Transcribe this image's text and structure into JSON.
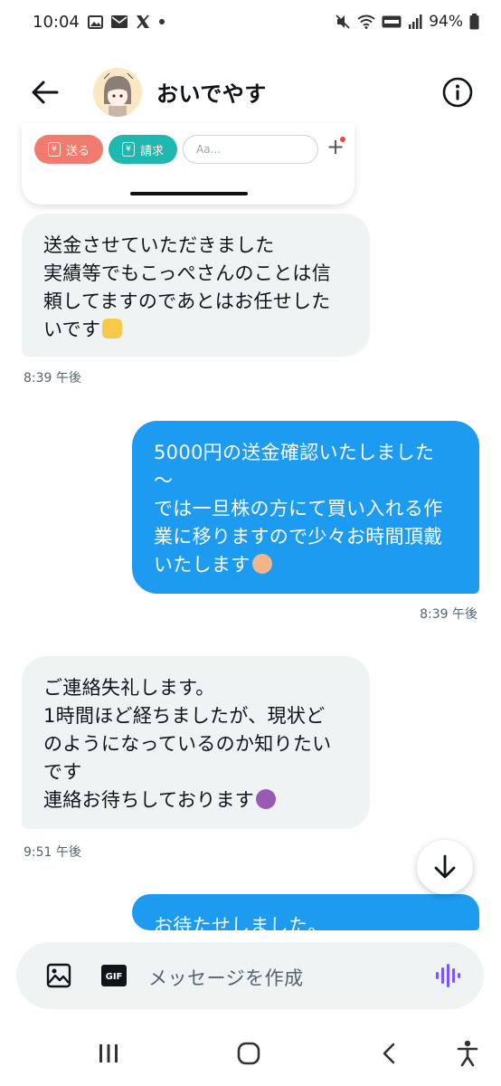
{
  "status_bar": {
    "time": "10:04",
    "battery": "94%",
    "icons": [
      "image-icon",
      "mail-icon",
      "x-icon",
      "dot-icon",
      "mute-icon",
      "wifi-icon",
      "volte-icon",
      "signal-icon",
      "battery-icon"
    ]
  },
  "header": {
    "contact_name": "おいでやす",
    "back_icon": "arrow-left-icon",
    "info_icon": "info-icon"
  },
  "pay_card": {
    "send_label": "送る",
    "request_label": "請求",
    "yen_symbol": "¥",
    "amount_placeholder": "Aa...",
    "plus_label": "+"
  },
  "messages": [
    {
      "direction": "incoming",
      "text": "送金させていただきました\n実績等でもこっぺさんのことは信\n頼してますのであとはお任せした\nいです",
      "emoji": "raising-hands-emoji",
      "time": "8:39 午後"
    },
    {
      "direction": "outgoing",
      "text": "5000円の送金確認いたしました\n〜\nでは一旦株の方にて買い入れる作\n業に移りますので少々お時間頂戴\nいたします",
      "emoji": "person-bowing-emoji",
      "time": "8:39 午後"
    },
    {
      "direction": "incoming",
      "text": "ご連絡失礼します。\n1時間ほど経ちましたが、現状ど\nのようになっているのか知りたい\nです\n連絡お待ちしております",
      "emoji": "person-bowing-emoji",
      "time": "9:51 午後"
    },
    {
      "direction": "outgoing",
      "text": "お待たせしました。"
    }
  ],
  "composer": {
    "placeholder": "メッセージを作成",
    "gif_label": "GIF"
  },
  "colors": {
    "incoming_bubble": "#eff3f4",
    "outgoing_bubble": "#1d9bf0",
    "send_button": "#f17b6e",
    "request_button": "#1fb8b0",
    "voice_accent": "#7856ff"
  }
}
